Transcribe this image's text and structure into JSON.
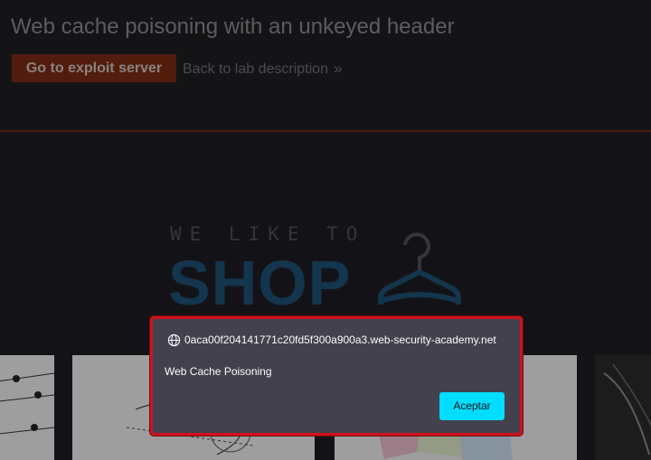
{
  "header": {
    "title": "Web cache poisoning with an unkeyed header",
    "exploit_button": "Go to exploit server",
    "back_link": "Back to lab description",
    "back_chevron": "»"
  },
  "logo": {
    "top_text": "WE LIKE TO",
    "main_text": "SHOP"
  },
  "dialog": {
    "origin": "0aca00f204141771c20fd5f300a900a3.web-security-academy.net",
    "message": "Web Cache Poisoning",
    "button": "Aceptar"
  },
  "colors": {
    "accent": "#7a2a12",
    "dialog_border": "#d0121b",
    "dialog_button": "#00ddff",
    "logo_blue": "#1d4f72"
  }
}
